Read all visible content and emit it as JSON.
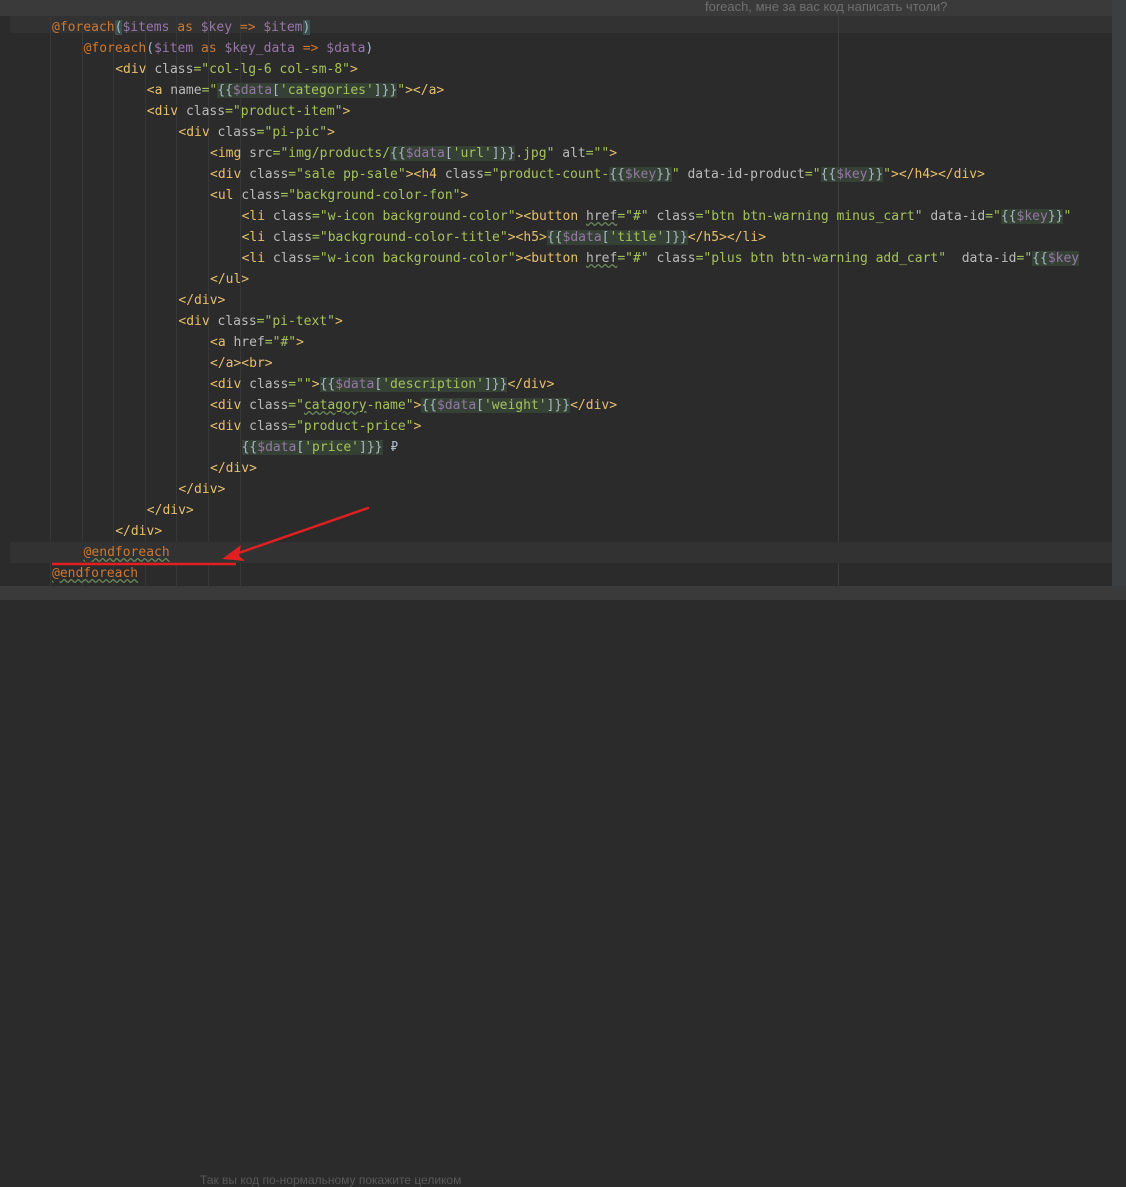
{
  "background": {
    "top_text": "foreach, мне за вас код написать чтоли?",
    "bottom_text": "Так вы код по-нормальному покажите целиком"
  },
  "colors": {
    "background": "#2b2b2b",
    "directive": "#cc7832",
    "variable": "#9876aa",
    "tag": "#e8bf6a",
    "attribute": "#bababa",
    "string": "#a5c25c",
    "text": "#a9b7c6",
    "annotation_arrow": "#e02020"
  },
  "code": {
    "lines": [
      [
        [
          "d",
          "@foreach"
        ],
        [
          "paren",
          "("
        ],
        [
          "v",
          "$items"
        ],
        [
          "d",
          " as "
        ],
        [
          "v",
          "$key"
        ],
        [
          "d",
          " => "
        ],
        [
          "v",
          "$item"
        ],
        [
          "paren",
          ")"
        ]
      ],
      [
        [
          "d",
          "@foreach"
        ],
        [
          "p",
          "("
        ],
        [
          "v",
          "$item"
        ],
        [
          "d",
          " as "
        ],
        [
          "v",
          "$key_data"
        ],
        [
          "d",
          " => "
        ],
        [
          "v",
          "$data"
        ],
        [
          "p",
          ")"
        ]
      ],
      [
        [
          "t",
          "<div "
        ],
        [
          "a",
          "class"
        ],
        [
          "s",
          "=\"col-lg-6 col-sm-8\""
        ],
        [
          "t",
          ">"
        ]
      ],
      [
        [
          "t",
          "<a "
        ],
        [
          "a",
          "name"
        ],
        [
          "s",
          "=\""
        ],
        [
          "pb",
          "{{"
        ],
        [
          "vb",
          "$data"
        ],
        [
          "pb",
          "["
        ],
        [
          "sb",
          "'categories'"
        ],
        [
          "pb",
          "]}}"
        ],
        [
          "s",
          "\""
        ],
        [
          "t",
          "></a>"
        ]
      ],
      [
        [
          "t",
          "<div "
        ],
        [
          "a",
          "class"
        ],
        [
          "s",
          "=\"product-item\""
        ],
        [
          "t",
          ">"
        ]
      ],
      [
        [
          "t",
          "<div "
        ],
        [
          "a",
          "class"
        ],
        [
          "s",
          "=\"pi-pic\""
        ],
        [
          "t",
          ">"
        ]
      ],
      [
        [
          "t",
          "<img "
        ],
        [
          "a",
          "src"
        ],
        [
          "s",
          "=\"img/products/"
        ],
        [
          "pb",
          "{{"
        ],
        [
          "vb",
          "$data"
        ],
        [
          "pb",
          "["
        ],
        [
          "sb",
          "'url'"
        ],
        [
          "pb",
          "]}}"
        ],
        [
          "s",
          ".jpg\""
        ],
        [
          "a",
          " alt"
        ],
        [
          "s",
          "=\"\""
        ],
        [
          "t",
          ">"
        ]
      ],
      [
        [
          "t",
          "<div "
        ],
        [
          "a",
          "class"
        ],
        [
          "s",
          "=\"sale pp-sale\""
        ],
        [
          "t",
          "><h4 "
        ],
        [
          "a",
          "class"
        ],
        [
          "s",
          "=\"product-count-"
        ],
        [
          "pb",
          "{{"
        ],
        [
          "vb",
          "$key"
        ],
        [
          "pb",
          "}}"
        ],
        [
          "s",
          "\""
        ],
        [
          "a",
          " data-id-product"
        ],
        [
          "s",
          "=\""
        ],
        [
          "pb",
          "{{"
        ],
        [
          "vb",
          "$key"
        ],
        [
          "pb",
          "}}"
        ],
        [
          "s",
          "\""
        ],
        [
          "t",
          "></h4></div>"
        ]
      ],
      [
        [
          "t",
          "<ul "
        ],
        [
          "a",
          "class"
        ],
        [
          "s",
          "=\"background-color-fon\""
        ],
        [
          "t",
          ">"
        ]
      ],
      [
        [
          "t",
          "<li "
        ],
        [
          "a",
          "class"
        ],
        [
          "s",
          "=\"w-icon background-color\""
        ],
        [
          "t",
          "><button "
        ],
        [
          "ab",
          "href"
        ],
        [
          "s",
          "=\"#\""
        ],
        [
          "a",
          " class"
        ],
        [
          "s",
          "=\"btn btn-warning minus_cart\""
        ],
        [
          "a",
          " data-id"
        ],
        [
          "s",
          "=\""
        ],
        [
          "pb",
          "{{"
        ],
        [
          "vb",
          "$key"
        ],
        [
          "pb",
          "}}"
        ],
        [
          "s",
          "\""
        ]
      ],
      [
        [
          "t",
          "<li "
        ],
        [
          "a",
          "class"
        ],
        [
          "s",
          "=\"background-color-title\""
        ],
        [
          "t",
          "><h5>"
        ],
        [
          "pb",
          "{{"
        ],
        [
          "vb",
          "$data"
        ],
        [
          "pb",
          "["
        ],
        [
          "sb",
          "'title'"
        ],
        [
          "pb",
          "]}}"
        ],
        [
          "t",
          "</h5></li>"
        ]
      ],
      [
        [
          "t",
          "<li "
        ],
        [
          "a",
          "class"
        ],
        [
          "s",
          "=\"w-icon background-color\""
        ],
        [
          "t",
          "><button "
        ],
        [
          "ab",
          "href"
        ],
        [
          "s",
          "=\"#\""
        ],
        [
          "a",
          " class"
        ],
        [
          "s",
          "=\"plus btn btn-warning add_cart\""
        ],
        [
          "a",
          "  data-id"
        ],
        [
          "s",
          "=\""
        ],
        [
          "pb",
          "{{"
        ],
        [
          "vb",
          "$key"
        ]
      ],
      [
        [
          "t",
          "</ul>"
        ]
      ],
      [
        [
          "t",
          "</div>"
        ]
      ],
      [
        [
          "t",
          "<div "
        ],
        [
          "a",
          "class"
        ],
        [
          "s",
          "=\"pi-text\""
        ],
        [
          "t",
          ">"
        ]
      ],
      [
        [
          "t",
          "<a "
        ],
        [
          "a",
          "href"
        ],
        [
          "s",
          "=\"#\""
        ],
        [
          "t",
          ">"
        ]
      ],
      [
        [
          "t",
          "</a><br>"
        ]
      ],
      [
        [
          "t",
          "<div "
        ],
        [
          "a",
          "class"
        ],
        [
          "s",
          "=\"\""
        ],
        [
          "t",
          ">"
        ],
        [
          "pb",
          "{{"
        ],
        [
          "vb",
          "$data"
        ],
        [
          "pb",
          "["
        ],
        [
          "sb",
          "'description'"
        ],
        [
          "pb",
          "]}}"
        ],
        [
          "t",
          "</div>"
        ]
      ],
      [
        [
          "t",
          "<div "
        ],
        [
          "a",
          "class"
        ],
        [
          "s",
          "=\""
        ],
        [
          "sq",
          "catagory"
        ],
        [
          "s",
          "-name\""
        ],
        [
          "t",
          ">"
        ],
        [
          "pb",
          "{{"
        ],
        [
          "vb",
          "$data"
        ],
        [
          "pb",
          "["
        ],
        [
          "sb",
          "'weight'"
        ],
        [
          "pb",
          "]}}"
        ],
        [
          "t",
          "</div>"
        ]
      ],
      [
        [
          "t",
          "<div "
        ],
        [
          "a",
          "class"
        ],
        [
          "s",
          "=\"product-price\""
        ],
        [
          "t",
          ">"
        ]
      ],
      [
        [
          "pb",
          "{{"
        ],
        [
          "vb",
          "$data"
        ],
        [
          "pb",
          "["
        ],
        [
          "sb",
          "'price'"
        ],
        [
          "pb",
          "]}}"
        ],
        [
          "p",
          " ₽"
        ]
      ],
      [
        [
          "t",
          "</div>"
        ]
      ],
      [
        [
          "t",
          "</div>"
        ]
      ],
      [
        [
          "t",
          "</div>"
        ]
      ],
      [
        [
          "t",
          "</div>"
        ]
      ],
      [
        [
          "dsq",
          "@endforeach"
        ]
      ],
      [
        [
          "dsq",
          "@endforeach"
        ]
      ]
    ]
  }
}
